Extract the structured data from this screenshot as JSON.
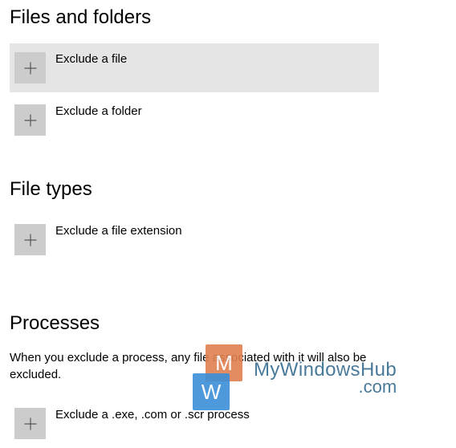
{
  "sections": {
    "files_folders": {
      "heading": "Files and folders",
      "items": [
        {
          "label": "Exclude a file"
        },
        {
          "label": "Exclude a folder"
        }
      ]
    },
    "file_types": {
      "heading": "File types",
      "items": [
        {
          "label": "Exclude a file extension"
        }
      ]
    },
    "processes": {
      "heading": "Processes",
      "description": "When you exclude a process, any file associated with it will also be excluded.",
      "items": [
        {
          "label": "Exclude a .exe, .com or .scr process"
        }
      ]
    }
  },
  "watermark": {
    "tile_m": "M",
    "tile_w": "W",
    "text": "MyWindowsHub",
    "suffix": ".com"
  }
}
